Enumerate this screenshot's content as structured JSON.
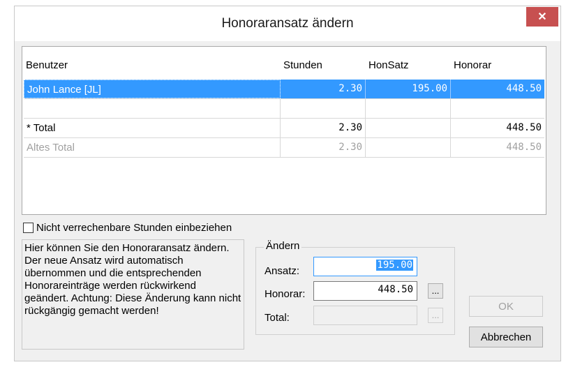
{
  "window": {
    "title": "Honoraransatz ändern",
    "close_label": "✕"
  },
  "grid": {
    "columns": [
      "Benutzer",
      "Stunden",
      "HonSatz",
      "Honorar"
    ],
    "rows": [
      {
        "benutzer": "John Lance [JL]",
        "stunden": "2.30",
        "honsatz": "195.00",
        "honorar": "448.50"
      },
      {
        "benutzer": "",
        "stunden": "",
        "honsatz": "",
        "honorar": ""
      },
      {
        "benutzer": "* Total",
        "stunden": "2.30",
        "honsatz": "",
        "honorar": "448.50"
      },
      {
        "benutzer": "Altes Total",
        "stunden": "2.30",
        "honsatz": "",
        "honorar": "448.50"
      }
    ]
  },
  "checkbox": {
    "label": "Nicht verrechenbare Stunden einbeziehen",
    "checked": false
  },
  "info_text": "Hier können Sie den Honoraransatz ändern. Der neue Ansatz wird automatisch übernommen und die entsprechenden Honorareinträge werden rückwirkend geändert. Achtung: Diese Änderung kann nicht rückgängig gemacht werden!",
  "change_group": {
    "label": "Ändern",
    "ansatz_label": "Ansatz:",
    "ansatz_value": "195.00",
    "honorar_label": "Honorar:",
    "honorar_value": "448.50",
    "total_label": "Total:",
    "total_value": "",
    "ellipsis": "..."
  },
  "buttons": {
    "ok": "OK",
    "cancel": "Abbrechen"
  }
}
